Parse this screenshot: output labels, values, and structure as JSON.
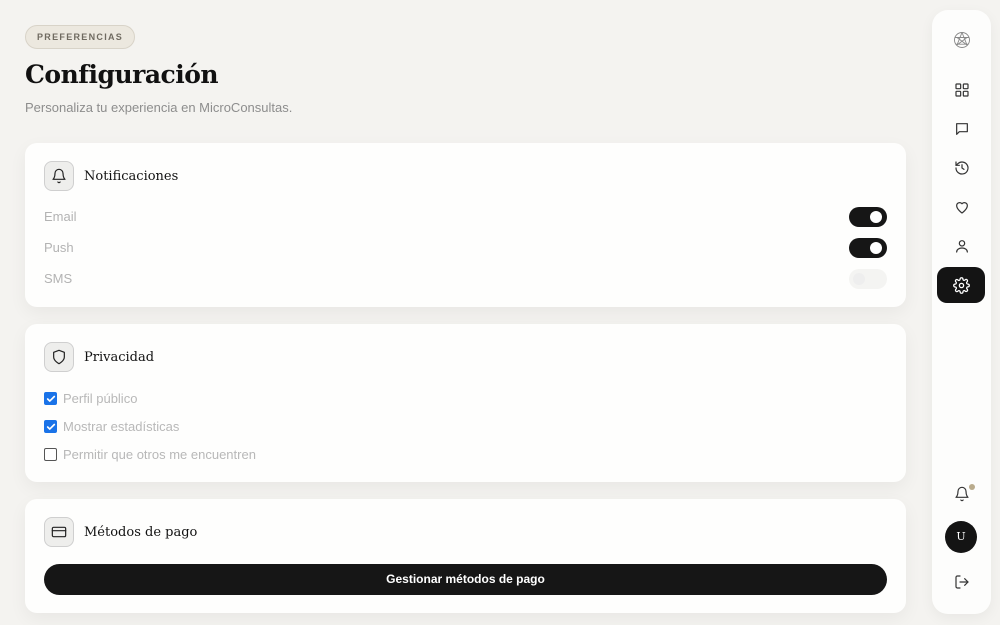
{
  "header": {
    "badge": "PREFERENCIAS",
    "title": "Configuración",
    "subtitle": "Personaliza tu experiencia en MicroConsultas."
  },
  "notifications": {
    "title": "Notificaciones",
    "icon": "bell-icon",
    "items": [
      {
        "label": "Email",
        "enabled": true
      },
      {
        "label": "Push",
        "enabled": true
      },
      {
        "label": "SMS",
        "enabled": false
      }
    ]
  },
  "privacy": {
    "title": "Privacidad",
    "icon": "shield-icon",
    "items": [
      {
        "label": "Perfil público",
        "checked": true
      },
      {
        "label": "Mostrar estadísticas",
        "checked": true
      },
      {
        "label": "Permitir que otros me encuentren",
        "checked": false
      }
    ]
  },
  "payment": {
    "title": "Métodos de pago",
    "icon": "credit-card-icon",
    "button_label": "Gestionar métodos de pago"
  },
  "sidebar": {
    "items": [
      {
        "icon": "logo-icon"
      },
      {
        "icon": "grid-icon"
      },
      {
        "icon": "chat-icon"
      },
      {
        "icon": "history-icon"
      },
      {
        "icon": "heart-icon"
      },
      {
        "icon": "user-icon"
      },
      {
        "icon": "gear-icon",
        "active": true
      }
    ],
    "avatar_initial": "U",
    "notification_icon": "bell-icon",
    "logout_icon": "logout-icon"
  },
  "colors": {
    "background": "#f4f3f0",
    "dark": "#161616",
    "checkbox": "#1a73e8",
    "accent": "#c9b68e"
  }
}
